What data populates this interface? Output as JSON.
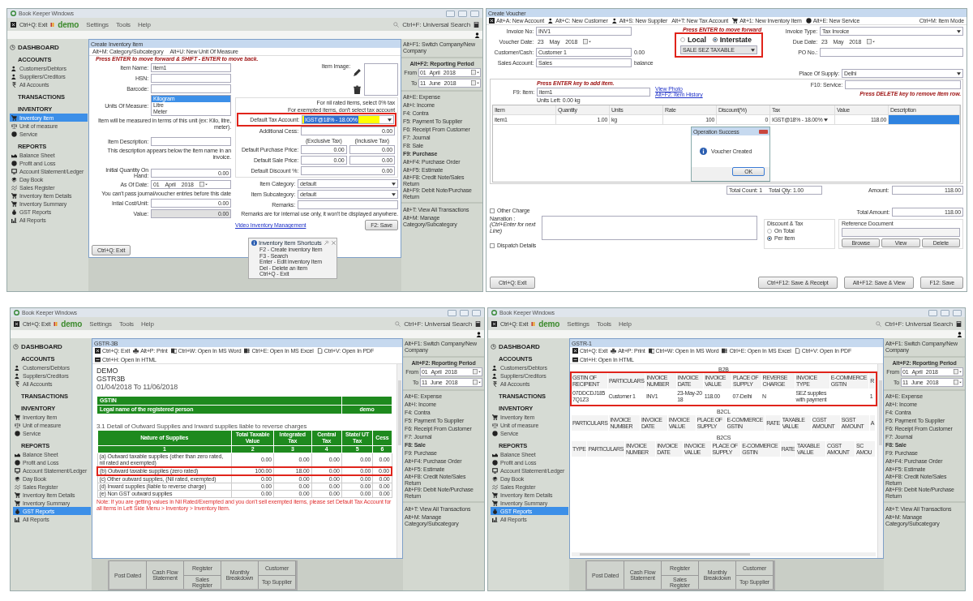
{
  "screens": [
    {
      "kind": "inventory",
      "shell": {
        "title": "Book Keeper Windows",
        "exit": "Ctrl+Q: Exit",
        "company": "demo",
        "menus": [
          "Settings",
          "Tools",
          "Help"
        ],
        "search": "Ctrl+F: Universal Search",
        "sidebar": {
          "dashboard": "DASHBOARD",
          "sections": [
            {
              "title": "ACCOUNTS",
              "items": [
                {
                  "label": "Customers/Debtors",
                  "selected": false
                },
                {
                  "label": "Suppliers/Creditors",
                  "selected": false
                },
                {
                  "label": "All Accounts",
                  "selected": false
                }
              ]
            },
            {
              "title": "TRANSACTIONS"
            },
            {
              "title": "INVENTORY",
              "items": [
                {
                  "label": "Inventory Item",
                  "selected": true
                },
                {
                  "label": "Unit of measure",
                  "selected": false
                },
                {
                  "label": "Service",
                  "selected": false
                }
              ]
            },
            {
              "title": "REPORTS",
              "items": [
                {
                  "label": "Balance Sheet",
                  "selected": false
                },
                {
                  "label": "Profit and Loss",
                  "selected": false
                },
                {
                  "label": "Account Statement/Ledger",
                  "selected": false
                },
                {
                  "label": "Day Book",
                  "selected": false
                },
                {
                  "label": "Sales Register",
                  "selected": false
                },
                {
                  "label": "Inventory Item Details",
                  "selected": false
                },
                {
                  "label": "Inventory Summary",
                  "selected": false
                },
                {
                  "label": "GST Reports",
                  "selected": false
                },
                {
                  "label": "All Reports",
                  "selected": false
                }
              ]
            }
          ]
        },
        "right": {
          "switch": "Alt+F1: Switch Company/New Company",
          "period": "Alt+F2: Reporting Period",
          "dates": [
            {
              "label": "From",
              "day": "01",
              "month": "April",
              "year": "2018"
            },
            {
              "label": "To",
              "day": "11",
              "month": "June",
              "year": "2018"
            }
          ],
          "shortcuts": [
            {
              "label": "Alt+E: Expense",
              "selected": false
            },
            {
              "label": "Alt+I: Income",
              "selected": false
            },
            {
              "label": "F4: Contra",
              "selected": false
            },
            {
              "label": "F5: Payment To Supplier",
              "selected": false
            },
            {
              "label": "F6: Receipt From Customer",
              "selected": false
            },
            {
              "label": "F7: Journal",
              "selected": false
            },
            {
              "label": "F8: Sale",
              "selected": false
            },
            {
              "label": "F9: Purchase",
              "selected": true
            },
            {
              "label": "Alt+F4: Purchase Order",
              "selected": false
            },
            {
              "label": "Alt+F5: Estimate",
              "selected": false
            },
            {
              "label": "Alt+F8: Credit Note/Sales Return",
              "selected": false
            },
            {
              "label": "Alt+F9: Debit Note/Purchase Return",
              "selected": false
            }
          ],
          "links": [
            "Alt+T: View All Transactions",
            "Alt+M: Manage Category/Subcategory"
          ]
        }
      },
      "dialog": {
        "title": "Create Inventory Item",
        "toolbar": [
          "Alt+M: Category/Subcategory",
          "Alt+U: New Unit Of Measure"
        ],
        "instruction": "Press ENTER to move forward & SHIFT - ENTER to move back.",
        "left_groups": [
          [
            {
              "kind": "text",
              "label": "Item Name:",
              "value": "item1"
            },
            {
              "kind": "text",
              "label": "HSN:"
            },
            {
              "kind": "text",
              "label": "Barcode:"
            },
            {
              "kind": "list",
              "label": "Units Of Measure:",
              "options": [
                {
                  "label": "Kilogram",
                  "selected": true
                },
                {
                  "label": "Litre",
                  "selected": false
                },
                {
                  "label": "Meter",
                  "selected": false
                }
              ]
            },
            {
              "kind": "hint",
              "text": "Item will be measured in terms of this unit (ex: Kilo, litre, meter)."
            }
          ],
          [
            {
              "kind": "text",
              "label": "Item Description:"
            },
            {
              "kind": "hint",
              "text": "This description appears below the item name in an invoice."
            }
          ],
          [
            {
              "kind": "number",
              "label": "Initial Quantity On Hand:",
              "value": "0.00"
            },
            {
              "kind": "date",
              "label": "As Of Date:",
              "day": "01",
              "month": "April",
              "year": "2018"
            },
            {
              "kind": "hint",
              "text": "You can't pass journal/voucher entries before this date"
            },
            {
              "kind": "number",
              "label": "Intial Cost/Unit:",
              "value": "0.00"
            },
            {
              "kind": "number",
              "label": "Value:",
              "value": "0.00",
              "disabled": true
            }
          ]
        ],
        "image": {
          "label": "Item Image:"
        },
        "tax": {
          "notes": [
            "For nil rated items, select 0% tax",
            "For exempted items, don't select tax account"
          ],
          "account": {
            "label": "Default Tax Account:",
            "value": "IGST@18% - 18.00%",
            "highlighted": true
          },
          "cess": {
            "label": "Additional Cess:",
            "value": "0.00"
          },
          "price_headers": [
            "(Exclusive Tax)",
            "(Inclusive Tax)"
          ],
          "prices": [
            {
              "label": "Default Purchase Price:",
              "values": [
                "0.00",
                "0.00"
              ]
            },
            {
              "label": "Default Sale Price:",
              "values": [
                "0.00",
                "0.00"
              ]
            }
          ],
          "discount": {
            "label": "Default Discount %:",
            "value": "0.00"
          }
        },
        "categories": [
          {
            "label": "Item Category:",
            "value": "default"
          },
          {
            "label": "Item Subcategory:",
            "value": "default"
          }
        ],
        "remarks": {
          "label": "Remarks:",
          "hint": "Remarks are for internal use only, it won't be displayed anywhere."
        },
        "exit": "Ctrl+Q: Exit",
        "save": "F2: Save",
        "link": "Video Inventory Management",
        "popup": {
          "title": "Inventory Item Shortcuts",
          "lines": [
            "F2 - Create inventory Item",
            "F3 - Search",
            "Enter - Edit inventory Item",
            "Del - Delete an item",
            "Ctrl+Q - Exit"
          ]
        }
      }
    },
    {
      "kind": "voucher",
      "window": {
        "title": "Create Voucher",
        "toolbar": [
          "Alt+A: New Account",
          "Alt+C: New Customer",
          "Alt+S: New Supplier",
          "Alt+T: New Tax Account",
          "Alt+1: New Inventory Item",
          "Alt+E: New Service"
        ],
        "mode": "Ctrl+M: Item Mode",
        "left_fields": [
          {
            "kind": "text",
            "label": "Invoice No:",
            "value": "INV1"
          },
          {
            "kind": "date",
            "label": "Voucher Date:",
            "day": "23",
            "month": "May",
            "year": "2018"
          },
          {
            "kind": "text",
            "label": "Customer/Cash:",
            "value": "Customer 1",
            "suffix": "0.00"
          },
          {
            "kind": "text",
            "label": "Sales Account:",
            "value": "Sales",
            "suffix": "balance"
          }
        ],
        "instruction": "Press ENTER to move forward",
        "tax_type": {
          "highlighted": true,
          "options": [
            {
              "label": "Local",
              "selected": false
            },
            {
              "label": "Interstate",
              "selected": true
            }
          ],
          "value": "SALE SEZ TAXABLE"
        },
        "right_fields": [
          {
            "kind": "select",
            "label": "Invoice Type:",
            "value": "Tax Invoice"
          },
          {
            "kind": "date",
            "label": "Due Date:",
            "day": "23",
            "month": "May",
            "year": "2018"
          },
          {
            "kind": "text",
            "label": "PO No.:"
          }
        ],
        "place": {
          "label": "Place Of Supply:",
          "value": "Delhi"
        },
        "items": {
          "instruction": "Press ENTER key to add item.",
          "item_label": "F9: Item:",
          "item_value": "item1",
          "units_left": "Units Left: 0.00 kg",
          "links": [
            "View Photo",
            "Alt+F2: Item History"
          ],
          "service_label": "F10: Service:",
          "delete_hint": "Press DELETE key to remove item row.",
          "columns": [
            "Item",
            "Quantity",
            "Units",
            "Rate",
            "Discount(%)",
            "Tax",
            "Value",
            "Description"
          ],
          "rows": [
            {
              "cells": [
                "item1",
                "1.00",
                "kg",
                "100",
                "0",
                "IGST@18% - 18.00%",
                "118.00"
              ],
              "selected": true
            }
          ]
        },
        "totals": {
          "summary": [
            "Total Count: 1",
            "Total Qty: 1.00"
          ],
          "amount_label": "Amount:",
          "amount": "118.00"
        },
        "other_charge": {
          "label": "Other Charge",
          "checked": false
        },
        "narration": {
          "label": "Narration :",
          "hint": "(Ctrl+Enter for next Line)"
        },
        "dispatch": {
          "label": "Dispatch Details",
          "checked": false
        },
        "total_amount": {
          "label": "Total Amount:",
          "value": "118.00"
        },
        "discount": {
          "title": "Discount & Tax",
          "options": [
            {
              "label": "On Total",
              "selected": false
            },
            {
              "label": "Per Item",
              "selected": true
            }
          ]
        },
        "reference": {
          "title": "Reference Document",
          "buttons": [
            "Browse",
            "View",
            "Delete"
          ]
        },
        "buttons": [
          "Ctrl+Q: Exit",
          "Ctrl+F12: Save & Receipt",
          "Alt+F12: Save & View",
          "F12: Save"
        ],
        "message": {
          "title": "Operation Success",
          "text": "Voucher Created",
          "button": "OK"
        }
      }
    },
    {
      "kind": "gstr3b",
      "shell": {
        "title": "Book Keeper Windows",
        "exit": "Ctrl+Q: Exit",
        "company": "demo",
        "menus": [
          "Settings",
          "Tools",
          "Help"
        ],
        "search": "Ctrl+F: Universal Search",
        "sidebar": {
          "dashboard": "DASHBOARD",
          "sections": [
            {
              "title": "ACCOUNTS",
              "items": [
                {
                  "label": "Customers/Debtors",
                  "selected": false
                },
                {
                  "label": "Suppliers/Creditors",
                  "selected": false
                },
                {
                  "label": "All Accounts",
                  "selected": false
                }
              ]
            },
            {
              "title": "TRANSACTIONS"
            },
            {
              "title": "INVENTORY",
              "items": [
                {
                  "label": "Inventory Item",
                  "selected": false
                },
                {
                  "label": "Unit of measure",
                  "selected": false
                },
                {
                  "label": "Service",
                  "selected": false
                }
              ]
            },
            {
              "title": "REPORTS",
              "items": [
                {
                  "label": "Balance Sheet",
                  "selected": false
                },
                {
                  "label": "Profit and Loss",
                  "selected": false
                },
                {
                  "label": "Account Statement/Ledger",
                  "selected": false
                },
                {
                  "label": "Day Book",
                  "selected": false
                },
                {
                  "label": "Sales Register",
                  "selected": false
                },
                {
                  "label": "Inventory Item Details",
                  "selected": false
                },
                {
                  "label": "Inventory Summary",
                  "selected": false
                },
                {
                  "label": "GST Reports",
                  "selected": true
                },
                {
                  "label": "All Reports",
                  "selected": false
                }
              ]
            }
          ]
        },
        "right": {
          "switch": "Alt+F1: Switch Company/New Company",
          "period": "Alt+F2: Reporting Period",
          "dates": [
            {
              "label": "From",
              "day": "01",
              "month": "April",
              "year": "2018"
            },
            {
              "label": "To",
              "day": "11",
              "month": "June",
              "year": "2018"
            }
          ],
          "shortcuts": [
            {
              "label": "Alt+E: Expense",
              "selected": false
            },
            {
              "label": "Alt+I: Income",
              "selected": false
            },
            {
              "label": "F4: Contra",
              "selected": false
            },
            {
              "label": "F5: Payment To Supplier",
              "selected": false
            },
            {
              "label": "F6: Receipt From Customer",
              "selected": false
            },
            {
              "label": "F7: Journal",
              "selected": false
            },
            {
              "label": "F8: Sale",
              "selected": true
            },
            {
              "label": "F9: Purchase",
              "selected": false
            },
            {
              "label": "Alt+F4: Purchase Order",
              "selected": false
            },
            {
              "label": "Alt+F5: Estimate",
              "selected": false
            },
            {
              "label": "Alt+F8: Credit Note/Sales Return",
              "selected": false
            },
            {
              "label": "Alt+F9: Debit Note/Purchase Return",
              "selected": false
            }
          ],
          "links": [
            "Alt+T: View All Transactions",
            "Alt+M: Manage Category/Subcategory"
          ]
        }
      },
      "tiles": [
        {
          "labels": [
            "Post Dated"
          ]
        },
        {
          "labels": [
            "Cash Flow Statement"
          ]
        },
        {
          "labels": [
            "Register",
            "Sales Register"
          ]
        },
        {
          "labels": [
            "Monthly Breakdown"
          ]
        },
        {
          "labels": [
            "Customer",
            "Top Supplier"
          ]
        }
      ],
      "dialog": {
        "title": "GSTR-3B",
        "toolbar": [
          "Ctrl+Q: Exit",
          "Alt+P: Print",
          "Ctrl+W: Open In MS Word",
          "Ctrl+E: Open In MS Excel",
          "Ctrl+V: Open In PDF",
          "Ctrl+H: Open In HTML"
        ],
        "company": "DEMO",
        "report": "GSTR3B",
        "period": "01/04/2018 To 11/06/2018",
        "info": [
          {
            "label": "GSTIN"
          },
          {
            "label": "Legal name of the registered person",
            "value": "demo"
          }
        ],
        "section": "3.1 Detail of Outward Supplies and Inward supplies liable to reverse charges",
        "columns": [
          "Nature of Supplies",
          "Total Taxable Value",
          "Integrated Tax",
          "Central Tax",
          "State/ UT Tax",
          "Cess"
        ],
        "numbers": [
          "1",
          "2",
          "3",
          "4",
          "5",
          "6"
        ],
        "rows": [
          {
            "label": "(a) Outward taxable supplies (other than zero rated, nil rated and exempted)",
            "values": [
              "0.00",
              "0.00",
              "0.00",
              "0.00",
              "0.00"
            ],
            "highlighted": false
          },
          {
            "label": "(b) Outward taxable supplies (zero rated)",
            "values": [
              "100.00",
              "18.00",
              "0.00",
              "0.00",
              "0.00"
            ],
            "highlighted": true
          },
          {
            "label": "(c) Other outward supplies, (Nil rated, exempted)",
            "values": [
              "0.00",
              "0.00",
              "0.00",
              "0.00",
              "0.00"
            ],
            "highlighted": false
          },
          {
            "label": "(d) Inward supplies (liable to reverse charge)",
            "values": [
              "0.00",
              "0.00",
              "0.00",
              "0.00",
              "0.00"
            ],
            "highlighted": false
          },
          {
            "label": "(e) Non GST outward supplies",
            "values": [
              "0.00",
              "0.00",
              "0.00",
              "0.00",
              "0.00"
            ],
            "highlighted": false
          }
        ],
        "note": "Note: If you are getting values in Nil Rated/Exempted and you don't sell exempted items, please set Default Tax Account for all items in Left Side Menu > Inventory > Inventory Item."
      }
    },
    {
      "kind": "gstr1",
      "shell": {
        "title": "Book Keeper Windows",
        "exit": "Ctrl+Q: Exit",
        "company": "demo",
        "menus": [
          "Settings",
          "Tools",
          "Help"
        ],
        "search": "Ctrl+F: Universal Search",
        "sidebar": {
          "dashboard": "DASHBOARD",
          "sections": [
            {
              "title": "ACCOUNTS",
              "items": [
                {
                  "label": "Customers/Debtors",
                  "selected": false
                },
                {
                  "label": "Suppliers/Creditors",
                  "selected": false
                },
                {
                  "label": "All Accounts",
                  "selected": false
                }
              ]
            },
            {
              "title": "TRANSACTIONS"
            },
            {
              "title": "INVENTORY",
              "items": [
                {
                  "label": "Inventory Item",
                  "selected": false
                },
                {
                  "label": "Unit of measure",
                  "selected": false
                },
                {
                  "label": "Service",
                  "selected": false
                }
              ]
            },
            {
              "title": "REPORTS",
              "items": [
                {
                  "label": "Balance Sheet",
                  "selected": false
                },
                {
                  "label": "Profit and Loss",
                  "selected": false
                },
                {
                  "label": "Account Statement/Ledger",
                  "selected": false
                },
                {
                  "label": "Day Book",
                  "selected": false
                },
                {
                  "label": "Sales Register",
                  "selected": false
                },
                {
                  "label": "Inventory Item Details",
                  "selected": false
                },
                {
                  "label": "Inventory Summary",
                  "selected": false
                },
                {
                  "label": "GST Reports",
                  "selected": true
                },
                {
                  "label": "All Reports",
                  "selected": false
                }
              ]
            }
          ]
        },
        "right": {
          "switch": "Alt+F1: Switch Company/New Company",
          "period": "Alt+F2: Reporting Period",
          "dates": [
            {
              "label": "From",
              "day": "01",
              "month": "April",
              "year": "2018"
            },
            {
              "label": "To",
              "day": "11",
              "month": "June",
              "year": "2018"
            }
          ],
          "shortcuts": [
            {
              "label": "Alt+E: Expense",
              "selected": false
            },
            {
              "label": "Alt+I: Income",
              "selected": false
            },
            {
              "label": "F4: Contra",
              "selected": false
            },
            {
              "label": "F5: Payment To Supplier",
              "selected": false
            },
            {
              "label": "F6: Receipt From Customer",
              "selected": false
            },
            {
              "label": "F7: Journal",
              "selected": false
            },
            {
              "label": "F8: Sale",
              "selected": true
            },
            {
              "label": "F9: Purchase",
              "selected": false
            },
            {
              "label": "Alt+F4: Purchase Order",
              "selected": false
            },
            {
              "label": "Alt+F5: Estimate",
              "selected": false
            },
            {
              "label": "Alt+F8: Credit Note/Sales Return",
              "selected": false
            },
            {
              "label": "Alt+F9: Debit Note/Purchase Return",
              "selected": false
            }
          ],
          "links": [
            "Alt+T: View All Transactions",
            "Alt+M: Manage Category/Subcategory"
          ]
        }
      },
      "tiles": [
        {
          "labels": [
            "Post Dated"
          ]
        },
        {
          "labels": [
            "Cash Flow Statement"
          ]
        },
        {
          "labels": [
            "Register",
            "Sales Register"
          ]
        },
        {
          "labels": [
            "Monthly Breakdown"
          ]
        },
        {
          "labels": [
            "Customer",
            "Top Supplier"
          ]
        }
      ],
      "dialog": {
        "title": "GSTR-1",
        "toolbar": [
          "Ctrl+Q: Exit",
          "Alt+P: Print",
          "Ctrl+W: Open In MS Word",
          "Ctrl+E: Open In MS Excel",
          "Ctrl+V: Open In PDF",
          "Ctrl+H: Open In HTML"
        ],
        "tables": [
          {
            "title": "B2B",
            "highlighted": true,
            "columns": [
              "GSTIN OF RECIPIENT",
              "PARTICULARS",
              "INVOICE NUMBER",
              "INVOICE DATE",
              "INVOICE VALUE",
              "PLACE OF SUPPLY",
              "REVERSE CHARGE",
              "INVOICE TYPE",
              "E-COMMERCE GSTIN",
              "R"
            ],
            "rows": [
              [
                "07DDCDJ1857Q1Z3",
                "Customer 1",
                "INV1",
                "23-May-2018",
                "118.00",
                "07-Delhi",
                "N",
                "SEZ supplies with payment",
                "",
                "1"
              ]
            ]
          },
          {
            "title": "B2CL",
            "highlighted": false,
            "columns": [
              "PARTICULARS",
              "INVOICE NUMBER",
              "INVOICE DATE",
              "INVOICE VALUE",
              "PLACE OF SUPPLY",
              "E-COMMERCE GSTIN",
              "RATE",
              "TAXABLE VALUE",
              "CGST AMOUNT",
              "SGST AMOUNT",
              "A"
            ]
          },
          {
            "title": "B2CS",
            "highlighted": false,
            "columns": [
              "TYPE",
              "PARTICULARS",
              "INVOICE NUMBER",
              "INVOICE DATE",
              "INVOICE VALUE",
              "PLACE OF SUPPLY",
              "E-COMMERCE GSTIN",
              "RATE",
              "TAXABLE VALUE",
              "CGST AMOUNT",
              "SC AMOU"
            ]
          }
        ]
      }
    }
  ]
}
